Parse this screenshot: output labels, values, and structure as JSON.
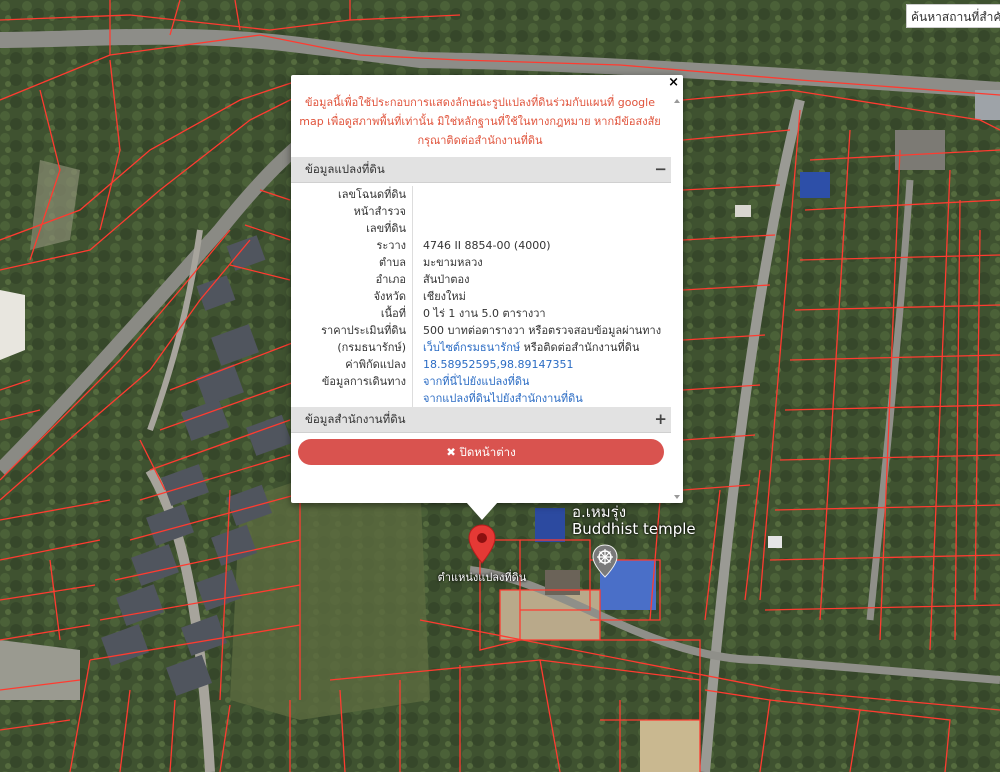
{
  "search": {
    "placeholder": "ค้นหาสถานที่สำคัญ"
  },
  "popup": {
    "notice": "ข้อมูลนี้เพื่อใช้ประกอบการแสดงลักษณะรูปแปลงที่ดินร่วมกับแผนที่ google map เพื่อดูสภาพพื้นที่เท่านั้น มิใช่หลักฐานที่ใช้ในทางกฎหมาย หากมีข้อสงสัย กรุณาติดต่อสำนักงานที่ดิน",
    "parcel_section_title": "ข้อมูลแปลงที่ดิน",
    "parcel_section_toggle": "−",
    "office_section_title": "ข้อมูลสำนักงานที่ดิน",
    "office_section_toggle": "+",
    "close_button_label": "✖ ปิดหน้าต่าง",
    "close_x": "×",
    "rows": [
      {
        "label": "เลขโฉนดที่ดิน",
        "value": "",
        "link": false
      },
      {
        "label": "หน้าสำรวจ",
        "value": "",
        "link": false
      },
      {
        "label": "เลขที่ดิน",
        "value": "",
        "link": false
      },
      {
        "label": "ระวาง",
        "value": "4746 II 8854-00 (4000)",
        "link": false
      },
      {
        "label": "ตำบล",
        "value": "มะขามหลวง",
        "link": false
      },
      {
        "label": "อำเภอ",
        "value": "สันป่าตอง",
        "link": false
      },
      {
        "label": "จังหวัด",
        "value": "เชียงใหม่",
        "link": false
      },
      {
        "label": "เนื้อที่",
        "value": "0 ไร่ 1 งาน 5.0 ตารางวา",
        "link": false
      },
      {
        "label": "ราคาประเมินที่ดิน",
        "value": "500 บาทต่อตารางวา หรือตรวจสอบข้อมูลผ่านทาง",
        "link": false
      },
      {
        "label": "(กรมธนารักษ์)",
        "value": "เว็บไซต์กรมธนารักษ์",
        "value_suffix": " หรือติดต่อสำนักงานที่ดิน",
        "link": true
      },
      {
        "label": "ค่าพิกัดแปลง",
        "value": "18.58952595,98.89147351",
        "link": true
      },
      {
        "label": "ข้อมูลการเดินทาง",
        "value": "จากที่นี่ไปยังแปลงที่ดิน",
        "link": true
      },
      {
        "label": "",
        "value": "จากแปลงที่ดินไปยังสำนักงานที่ดิน",
        "link": true
      }
    ]
  },
  "map": {
    "marker_label": "ตำแหน่งแปลงที่ดิน",
    "place_name_th": "อ.เหมรุ่ง",
    "place_name_en": "Buddhist temple",
    "marker_color": "#e53935",
    "parcel_line_color": "#ff3b30"
  }
}
